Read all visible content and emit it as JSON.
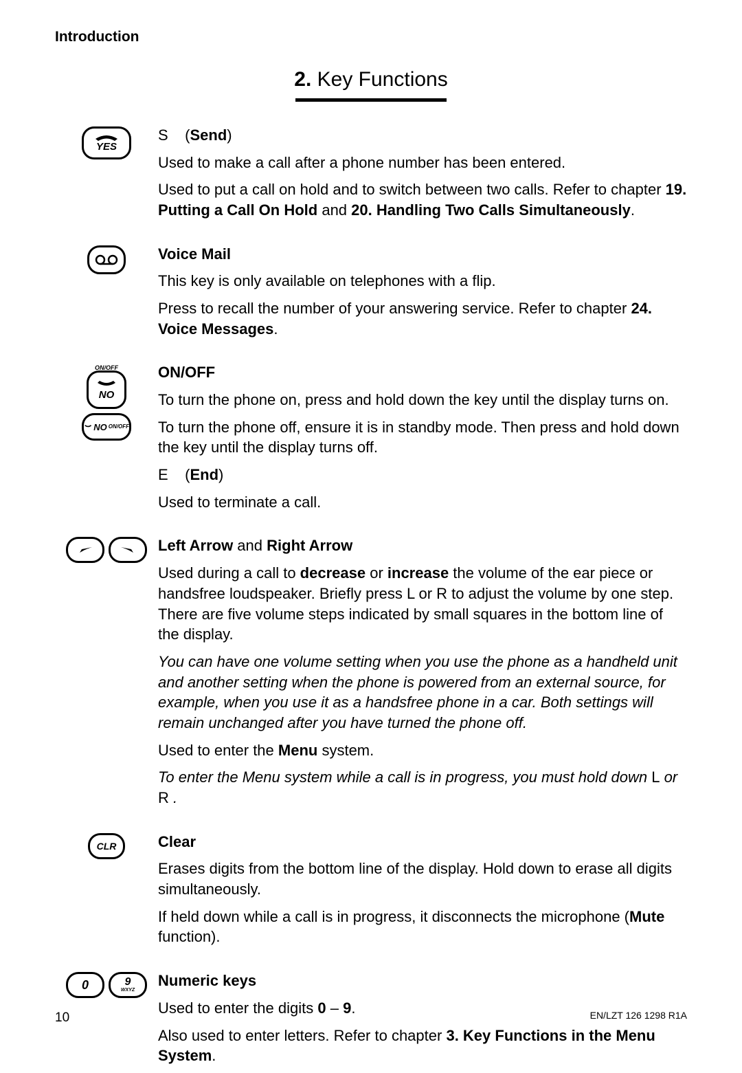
{
  "header": "Introduction",
  "title_num": "2.",
  "title_text": "Key Functions",
  "entries": {
    "send": {
      "key_label": "YES",
      "letter": "S",
      "name": "Send",
      "p1": "Used to make a call after a phone number has been entered.",
      "p2a": "Used to put a call on hold and to switch between two calls. Refer to chapter ",
      "ref1": "19. Putting a Call On Hold",
      "and": " and ",
      "ref2": "20. Handling Two Calls Simultaneously",
      "dot": "."
    },
    "voicemail": {
      "title": "Voice Mail",
      "p1": "This key is only available on telephones with a flip.",
      "p2a": "Press to recall the number of your answering service. Refer to chapter ",
      "ref": "24. Voice Messages",
      "dot": "."
    },
    "onoff": {
      "top": "ON/OFF",
      "key_label": "NO",
      "key_sub": "ON/OFF",
      "title": "ON/OFF",
      "p1": "To turn the phone on, press and hold down the key until the display turns on.",
      "p2": "To turn the phone off, ensure it is in standby mode. Then press and hold down the key until the display turns off.",
      "letter": "E",
      "name": "End",
      "p3": "Used to terminate a call."
    },
    "arrows": {
      "title_a": "Left Arrow",
      "title_and": " and ",
      "title_b": "Right Arrow",
      "p1a": "Used during a call to ",
      "p1b_dec": "decrease",
      "p1c": " or ",
      "p1d_inc": "increase",
      "p1e": " the volume of the ear piece or handsfree loudspeaker. Briefly press L   or R   to adjust the volume by one step. There are five volume steps indicated by small squares in the bottom line of the display.",
      "note1": "You can have one volume setting when you use the phone as a handheld unit and another setting when the phone is powered from an external source, for example, when you use it as a handsfree phone in a car. Both settings will remain unchanged after you have turned the phone off.",
      "p2a": "Used to enter the ",
      "p2b_menu": "Menu",
      "p2c": " system.",
      "note2": "To enter the Menu system while a call is in progress, you must hold down ",
      "note2_L": "L",
      "note2_mid": "   or ",
      "note2_R": "R",
      "note2_end": " ."
    },
    "clear": {
      "key_label": "CLR",
      "title": "Clear",
      "p1": "Erases digits from the bottom line of the display. Hold down to erase all digits simultaneously.",
      "p2a": "If held down while a call is in progress, it disconnects the microphone (",
      "p2b_mute": "Mute",
      "p2c": " function)."
    },
    "numeric": {
      "key0": "0",
      "key9": "9",
      "key9sub": "WXYZ",
      "title": "Numeric keys",
      "p1a": "Used to enter the digits ",
      "p1b_0": "0",
      "p1c": " – ",
      "p1d_9": "9",
      "p1e": ".",
      "p2a": "Also used to enter letters. Refer to chapter ",
      "ref": "3. Key Functions in the Menu System",
      "dot": "."
    }
  },
  "footer": {
    "page": "10",
    "docref": "EN/LZT 126 1298 R1A"
  }
}
